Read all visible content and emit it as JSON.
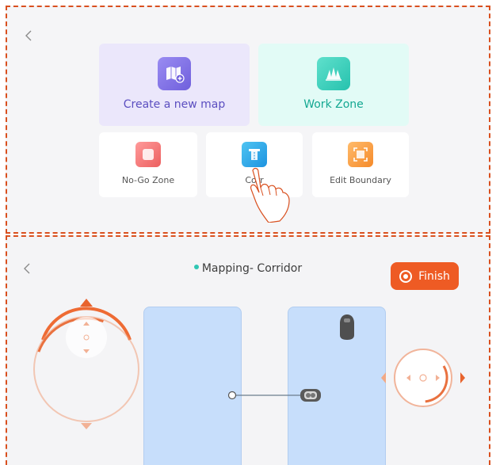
{
  "top_screen": {
    "cards": {
      "create_map": {
        "label": "Create a new map",
        "icon": "map-add-icon"
      },
      "work_zone": {
        "label": "Work Zone",
        "icon": "grass-icon"
      },
      "no_go_zone": {
        "label": "No-Go Zone",
        "icon": "square-icon"
      },
      "corridor": {
        "label": "Corr",
        "icon": "corridor-road-icon"
      },
      "edit_boundary": {
        "label": "Edit Boundary",
        "icon": "boundary-frame-icon"
      }
    }
  },
  "bottom_screen": {
    "title": "Mapping- Corridor",
    "status_dot_color": "#2fc6b3",
    "finish_label": "Finish",
    "accent_color": "#ee5b24"
  }
}
